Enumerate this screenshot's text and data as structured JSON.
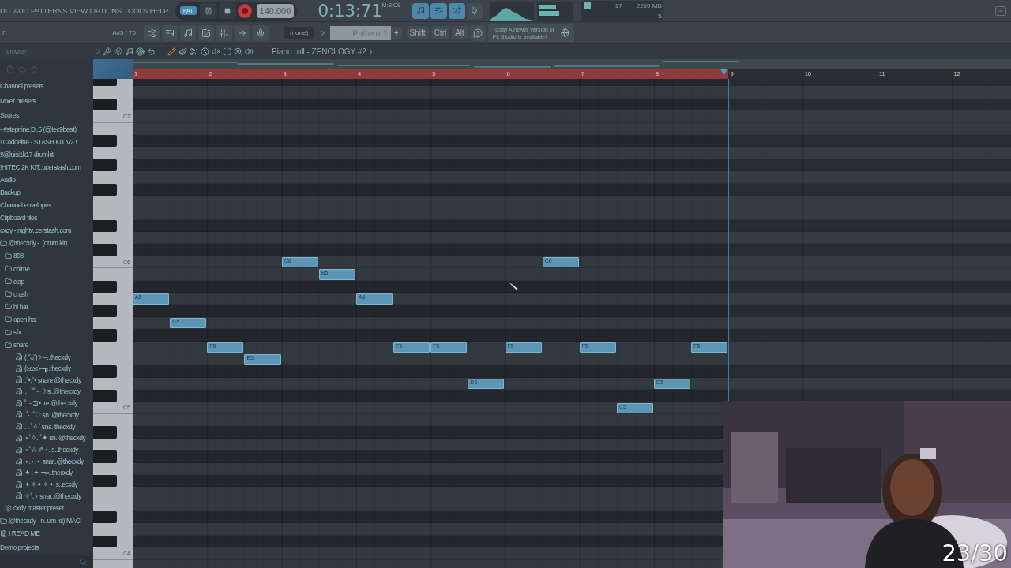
{
  "menu": [
    "DIT",
    "ADD",
    "PATTERNS",
    "VIEW",
    "OPTIONS",
    "TOOLS",
    "HELP"
  ],
  "transport": {
    "mode": "PAT",
    "tempo": "140.000",
    "time": "0:13:71",
    "time_unit": "M:S:CS",
    "recording": true
  },
  "monitor": {
    "cpu": "17",
    "memory": "2299 MB",
    "polyphony": "5"
  },
  "toolbar": {
    "left_value": "7",
    "hint_note": "A#5 / 70",
    "channel": "(none)",
    "pattern": "Pattern 1",
    "add": "+",
    "modifiers": [
      "Shift",
      "Ctrl",
      "Alt"
    ],
    "hint_day": "Today",
    "hint_text": "A newer version of",
    "hint_text_2": "FL Studio is available!"
  },
  "browser": {
    "title": "Browser",
    "items": [
      {
        "label": "Channel presets",
        "kind": "category"
      },
      {
        "label": "Mixer presets",
        "kind": "category"
      },
      {
        "label": "Scores",
        "kind": "category"
      },
      {
        "label": "- #stepnine.D..5 (@tec9beat)",
        "kind": "pack"
      },
      {
        "label": "! Coddeine - STASH KIT V2 !",
        "kind": "pack"
      },
      {
        "label": "!!@luisi1k17 drumkit",
        "kind": "pack"
      },
      {
        "label": "!HITEC 2K KIT..ucerstash.com",
        "kind": "pack"
      },
      {
        "label": "Audio",
        "kind": "pack"
      },
      {
        "label": "Backup",
        "kind": "pack"
      },
      {
        "label": "Channel envelopes",
        "kind": "pack"
      },
      {
        "label": "Clipboard files",
        "kind": "pack"
      },
      {
        "label": "cxdy - nightv..cerstash.com",
        "kind": "pack"
      },
      {
        "label": "@thecxdy -..(drum kit)",
        "kind": "folder",
        "expanded": true,
        "children": [
          {
            "label": "808",
            "kind": "folder",
            "expanded": false
          },
          {
            "label": "chime",
            "kind": "folder",
            "expanded": false
          },
          {
            "label": "clap",
            "kind": "folder",
            "expanded": false
          },
          {
            "label": "crash",
            "kind": "folder",
            "expanded": false
          },
          {
            "label": "hi hat",
            "kind": "folder",
            "expanded": false
          },
          {
            "label": "open hat",
            "kind": "folder",
            "expanded": false
          },
          {
            "label": "sfx",
            "kind": "folder",
            "expanded": false
          },
          {
            "label": "snare",
            "kind": "folder",
            "expanded": true,
            "children": [
              {
                "label": "(˳˘ᴗ˘)✧━..thecxdy",
                "kind": "file"
              },
              {
                "label": "(≥ω≤)━┳..thecxdy",
                "kind": "file"
              },
              {
                "label": ".°•.°• snare @thecxdy",
                "kind": "file"
              },
              {
                "label": "。˚˚ - ☽ s..@thecxdy",
                "kind": "file"
              },
              {
                "label": "˚ .- ⊒•..re @thecxdy",
                "kind": "file"
              },
              {
                "label": ".˚·. ˚♡ sn..@thecxdy",
                "kind": "file"
              },
              {
                "label": ". . ˚✧˚ sna..thecxdy",
                "kind": "file"
              },
              {
                "label": "⋆˚✧. ˚✦ sn..@thecxdy",
                "kind": "file"
              },
              {
                "label": "⋆˚☆ ✐⋆. s..thecxdy",
                "kind": "file"
              },
              {
                "label": "⋆.⋆.⋆ snar..@thecxdy",
                "kind": "file"
              },
              {
                "label": "✦↓✦ ━╤..thecxdy",
                "kind": "file"
              },
              {
                "label": "✦✧✦✧✦ s..ecxdy",
                "kind": "file"
              },
              {
                "label": "✧˚.⋆ snar..@thecxdy",
                "kind": "file"
              }
            ]
          },
          {
            "label": "cxdy master preset",
            "kind": "preset"
          }
        ]
      },
      {
        "label": "@thecxdy - n..um kit) MAC",
        "kind": "folder",
        "expanded": false
      },
      {
        "label": "I READ ME",
        "kind": "text"
      },
      {
        "label": "Demo projects",
        "kind": "category"
      }
    ]
  },
  "piano_roll": {
    "title": "Piano roll - ZENOLOGY #2",
    "title_arrow": "›",
    "bar_numbers": [
      "1",
      "2",
      "3",
      "4",
      "5",
      "6",
      "7",
      "8",
      "9",
      "10",
      "11",
      "12"
    ],
    "octave_labels": [
      "C7",
      "C6",
      "C5",
      "C4"
    ],
    "notes": [
      {
        "pitch": "A5"
      },
      {
        "pitch": "G5"
      },
      {
        "pitch": "F5"
      },
      {
        "pitch": "E5"
      },
      {
        "pitch": "C6"
      },
      {
        "pitch": "B5"
      },
      {
        "pitch": "A5"
      },
      {
        "pitch": "F5"
      },
      {
        "pitch": "F5"
      },
      {
        "pitch": "D5"
      },
      {
        "pitch": "F5"
      },
      {
        "pitch": "C6"
      },
      {
        "pitch": "F5"
      },
      {
        "pitch": "C5"
      },
      {
        "pitch": "D5"
      },
      {
        "pitch": "F5"
      }
    ]
  },
  "counter": "23/30"
}
